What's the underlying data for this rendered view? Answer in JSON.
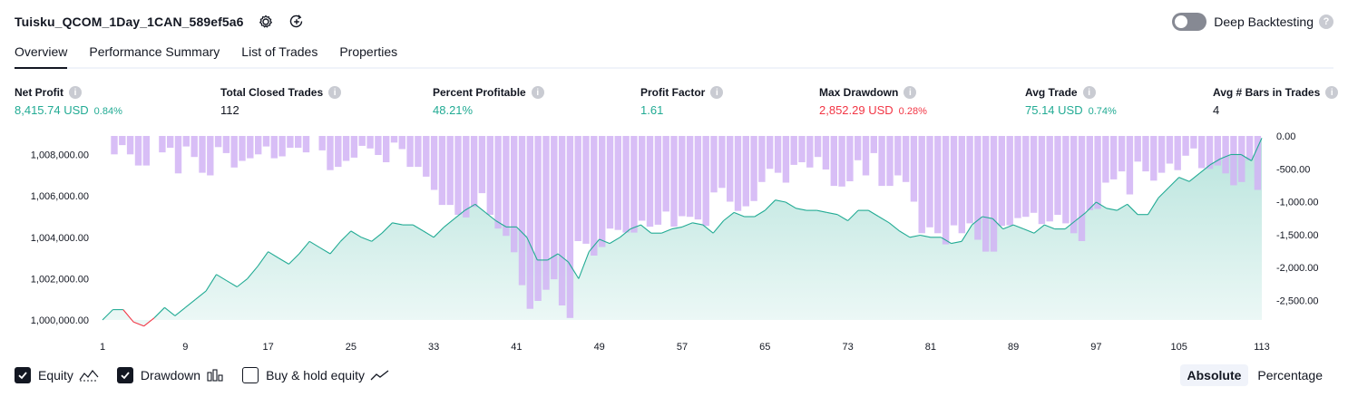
{
  "header": {
    "title": "Tuisku_QCOM_1Day_1CAN_589ef5a6",
    "deep_backtesting_label": "Deep Backtesting",
    "help_glyph": "?"
  },
  "tabs": [
    {
      "label": "Overview",
      "active": true
    },
    {
      "label": "Performance Summary",
      "active": false
    },
    {
      "label": "List of Trades",
      "active": false
    },
    {
      "label": "Properties",
      "active": false
    }
  ],
  "metrics": [
    {
      "label": "Net Profit",
      "value": "8,415.74 USD",
      "pct": "0.84%",
      "color": "#22ab94"
    },
    {
      "label": "Total Closed Trades",
      "value": "112",
      "pct": "",
      "color": "#131722"
    },
    {
      "label": "Percent Profitable",
      "value": "48.21%",
      "pct": "",
      "color": "#22ab94"
    },
    {
      "label": "Profit Factor",
      "value": "1.61",
      "pct": "",
      "color": "#22ab94"
    },
    {
      "label": "Max Drawdown",
      "value": "2,852.29 USD",
      "pct": "0.28%",
      "color": "#f23645"
    },
    {
      "label": "Avg Trade",
      "value": "75.14 USD",
      "pct": "0.74%",
      "color": "#22ab94"
    },
    {
      "label": "Avg # Bars in Trades",
      "value": "4",
      "pct": "",
      "color": "#131722"
    }
  ],
  "info_glyph": "i",
  "chart_data": {
    "type": "area",
    "x_ticks": [
      "1",
      "9",
      "17",
      "25",
      "33",
      "41",
      "49",
      "57",
      "65",
      "73",
      "81",
      "89",
      "97",
      "105",
      "113"
    ],
    "left_axis_ticks": [
      "1,008,000.00",
      "1,006,000.00",
      "1,004,000.00",
      "1,002,000.00",
      "1,000,000.00"
    ],
    "right_axis_ticks": [
      "0.00",
      "-500.00",
      "-1,000.00",
      "-1,500.00",
      "-2,000.00",
      "-2,500.00"
    ],
    "x_range": [
      1,
      113
    ],
    "equity_ylim": [
      1000000,
      1008900
    ],
    "drawdown_ylim": [
      -2800,
      0
    ],
    "series": [
      {
        "name": "Equity",
        "color": "#22ab94",
        "values": [
          1000000,
          1000500,
          1000500,
          999900,
          999700,
          1000100,
          1000600,
          1000200,
          1000600,
          1001000,
          1001400,
          1002200,
          1001900,
          1001600,
          1002000,
          1002600,
          1003300,
          1003000,
          1002700,
          1003200,
          1003800,
          1003500,
          1003200,
          1003800,
          1004300,
          1004000,
          1003800,
          1004200,
          1004700,
          1004600,
          1004600,
          1004300,
          1004000,
          1004500,
          1004900,
          1005300,
          1005600,
          1005200,
          1004800,
          1004500,
          1004500,
          1004000,
          1002900,
          1002900,
          1003200,
          1002800,
          1002000,
          1003300,
          1003900,
          1003700,
          1004000,
          1004400,
          1004600,
          1004200,
          1004200,
          1004400,
          1004500,
          1004700,
          1004600,
          1004200,
          1004800,
          1005200,
          1005000,
          1005000,
          1005300,
          1005800,
          1005700,
          1005400,
          1005300,
          1005300,
          1005200,
          1005100,
          1004800,
          1005300,
          1005300,
          1005000,
          1004700,
          1004300,
          1004000,
          1004100,
          1004000,
          1004000,
          1003700,
          1003800,
          1004600,
          1005000,
          1004900,
          1004400,
          1004600,
          1004400,
          1004200,
          1004600,
          1004400,
          1004400,
          1004800,
          1005200,
          1005700,
          1005400,
          1005300,
          1005600,
          1005100,
          1005100,
          1005900,
          1006400,
          1006900,
          1006700,
          1007100,
          1007500,
          1007800,
          1008000,
          1008000,
          1007700,
          1008800
        ]
      },
      {
        "name": "Drawdown",
        "color": "#d1b3f5",
        "values": [
          0,
          -280,
          -140,
          -280,
          -450,
          -450,
          0,
          -250,
          -180,
          -570,
          -160,
          -320,
          -560,
          -600,
          -170,
          -260,
          -480,
          -380,
          -340,
          -280,
          -160,
          -340,
          -310,
          -180,
          -180,
          -250,
          0,
          -220,
          -520,
          -470,
          -380,
          -330,
          -150,
          -190,
          -290,
          -400,
          -100,
          -200,
          -470,
          -470,
          -620,
          -820,
          -1050,
          -1050,
          -1200,
          -1240,
          -1080,
          -870,
          -1200,
          -1410,
          -1520,
          -1770,
          -2270,
          -2630,
          -2510,
          -2340,
          -2180,
          -2580,
          -2770,
          -1600,
          -1640,
          -1820,
          -1690,
          -1410,
          -1430,
          -1470,
          -1470,
          -1290,
          -1380,
          -1350,
          -1150,
          -1380,
          -1220,
          -1230,
          -1270,
          -1370,
          -860,
          -790,
          -1000,
          -1140,
          -1070,
          -990,
          -700,
          -500,
          -560,
          -710,
          -440,
          -400,
          -480,
          -320,
          -510,
          -760,
          -770,
          -690,
          -370,
          -600,
          -260,
          -760,
          -760,
          -600,
          -700,
          -1000,
          -1480,
          -1390,
          -1480,
          -1650,
          -1360,
          -1480,
          -1330,
          -1580,
          -1760,
          -1760,
          -1370,
          -1360,
          -1250,
          -1230,
          -1170,
          -1340,
          -1300,
          -1200,
          -1330,
          -1480,
          -1600,
          -1130,
          -1110,
          -710,
          -660,
          -540,
          -890,
          -390,
          -540,
          -680,
          -560,
          -420,
          -520,
          -300,
          -190,
          -490,
          -500,
          -450,
          -570,
          -750,
          -700,
          -370,
          -820
        ]
      }
    ]
  },
  "legend": [
    {
      "label": "Equity",
      "checked": true,
      "icon": "equity-icon"
    },
    {
      "label": "Drawdown",
      "checked": true,
      "icon": "drawdown-bars-icon"
    },
    {
      "label": "Buy & hold equity",
      "checked": false,
      "icon": "buy-hold-icon"
    }
  ],
  "scale_mode": {
    "options": [
      "Absolute",
      "Percentage"
    ],
    "selected": "Absolute"
  }
}
